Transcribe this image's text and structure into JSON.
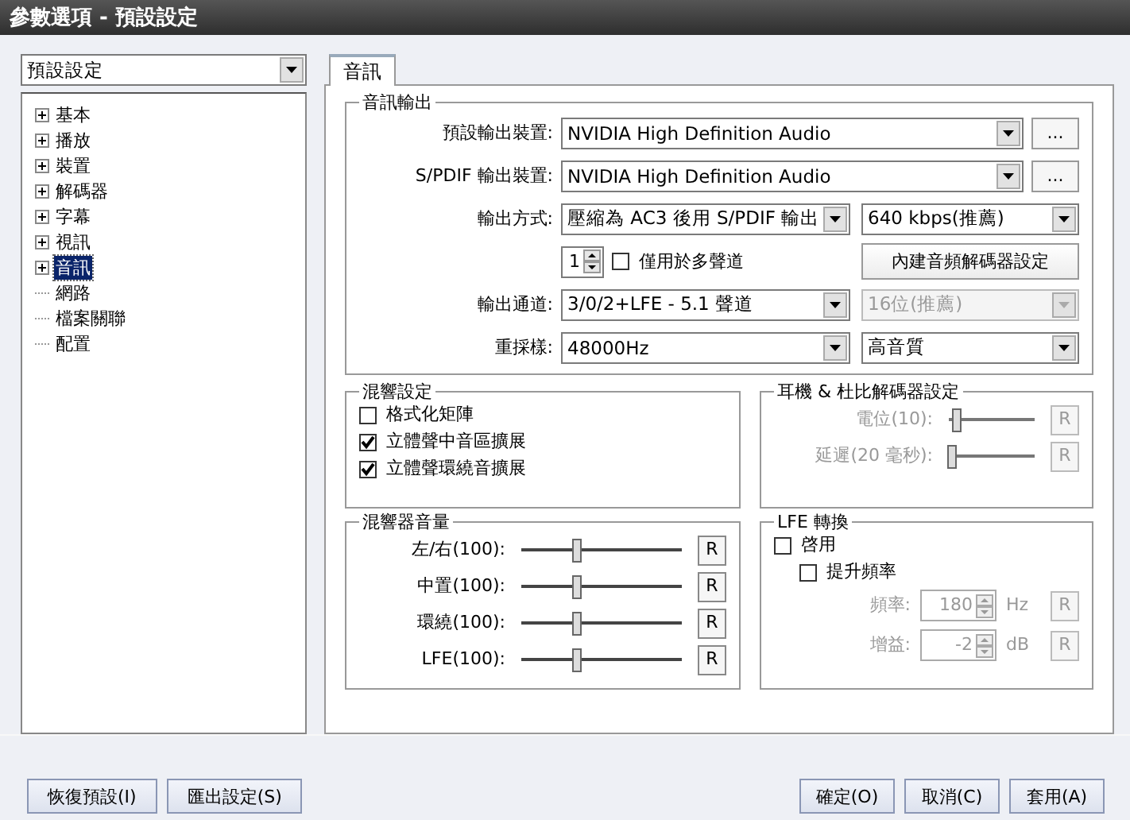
{
  "window": {
    "title": "參數選項 - 預設設定"
  },
  "preset_dropdown": {
    "value": "預設設定"
  },
  "tree": [
    {
      "label": "基本",
      "expandable": true,
      "selected": false
    },
    {
      "label": "播放",
      "expandable": true,
      "selected": false
    },
    {
      "label": "裝置",
      "expandable": true,
      "selected": false
    },
    {
      "label": "解碼器",
      "expandable": true,
      "selected": false
    },
    {
      "label": "字幕",
      "expandable": true,
      "selected": false
    },
    {
      "label": "視訊",
      "expandable": true,
      "selected": false
    },
    {
      "label": "音訊",
      "expandable": true,
      "selected": true
    },
    {
      "label": "網路",
      "expandable": false,
      "selected": false
    },
    {
      "label": "檔案關聯",
      "expandable": false,
      "selected": false
    },
    {
      "label": "配置",
      "expandable": false,
      "selected": false
    }
  ],
  "tabs": [
    {
      "label": "音訊",
      "selected": true
    }
  ],
  "audio_output": {
    "title": "音訊輸出",
    "default_device": {
      "label": "預設輸出裝置:",
      "value": "NVIDIA High Definition Audio",
      "more": "..."
    },
    "spdif_device": {
      "label": "S/PDIF 輸出裝置:",
      "value": "NVIDIA High Definition Audio",
      "more": "..."
    },
    "output_mode": {
      "label": "輸出方式:",
      "value": "壓縮為 AC3 後用 S/PDIF 輸出",
      "bitrate": "640 kbps(推薦)"
    },
    "count_spinner": {
      "value": "1"
    },
    "multichannel_only": {
      "label": "僅用於多聲道",
      "checked": false
    },
    "decoder_button": "內建音頻解碼器設定",
    "output_channels": {
      "label": "輸出通道:",
      "value": "3/0/2+LFE - 5.1 聲道",
      "bits": {
        "value": "16位(推薦)",
        "disabled": true
      }
    },
    "resample": {
      "label": "重採樣:",
      "value": "48000Hz",
      "quality": "高音質"
    }
  },
  "mixer_settings": {
    "title": "混響設定",
    "options": [
      {
        "label": "格式化矩陣",
        "checked": false
      },
      {
        "label": "立體聲中音區擴展",
        "checked": true
      },
      {
        "label": "立體聲環繞音擴展",
        "checked": true
      }
    ]
  },
  "headphone": {
    "title": "耳機 & 杜比解碼器設定",
    "disabled": true,
    "sliders": [
      {
        "label": "電位(10):",
        "level": 0.1,
        "reset": "R"
      },
      {
        "label": "延遲(20 毫秒):",
        "level": 0.03,
        "reset": "R"
      }
    ]
  },
  "mixer_volume": {
    "title": "混響器音量",
    "sliders": [
      {
        "label": "左/右(100):",
        "level": 0.35,
        "reset": "R"
      },
      {
        "label": "中置(100):",
        "level": 0.35,
        "reset": "R"
      },
      {
        "label": "環繞(100):",
        "level": 0.35,
        "reset": "R"
      },
      {
        "label": "LFE(100):",
        "level": 0.35,
        "reset": "R"
      }
    ]
  },
  "lfe": {
    "title": "LFE 轉換",
    "enable": {
      "label": "啓用",
      "checked": false
    },
    "boost": {
      "label": "提升頻率",
      "checked": false
    },
    "fields": [
      {
        "label": "頻率:",
        "value": "180",
        "unit": "Hz",
        "reset": "R",
        "disabled": true
      },
      {
        "label": "增益:",
        "value": "-2",
        "unit": "dB",
        "reset": "R",
        "disabled": true
      }
    ]
  },
  "footer": {
    "left_buttons": [
      "恢復預設(I)",
      "匯出設定(S)"
    ],
    "right_buttons": [
      "確定(O)",
      "取消(C)",
      "套用(A)"
    ]
  }
}
